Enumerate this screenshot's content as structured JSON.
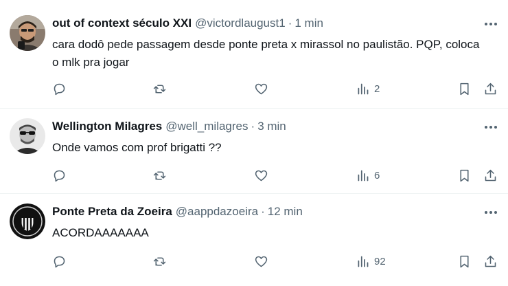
{
  "tweets": [
    {
      "author": "out of context século XXI",
      "handle": "@victordlaugust1",
      "separator": "·",
      "time": "1 min",
      "text": "cara dodô pede passagem desde ponte preta x mirassol no paulistão. PQP, coloca o mlk pra jogar",
      "views": "2",
      "avatar_icon": "person-avatar-icon"
    },
    {
      "author": "Wellington Milagres",
      "handle": "@well_milagres",
      "separator": "·",
      "time": "3 min",
      "text": "Onde vamos com prof brigatti ??",
      "views": "6",
      "avatar_icon": "person-sunglasses-avatar-icon"
    },
    {
      "author": "Ponte Preta da Zoeira",
      "handle": "@aappdazoeira",
      "separator": "·",
      "time": "12 min",
      "text": "ACORDAAAAAAA",
      "views": "92",
      "avatar_icon": "ponte-preta-crest-avatar-icon"
    }
  ],
  "colors": {
    "text_primary": "#0f1419",
    "text_secondary": "#536471",
    "divider": "#eff3f4"
  }
}
